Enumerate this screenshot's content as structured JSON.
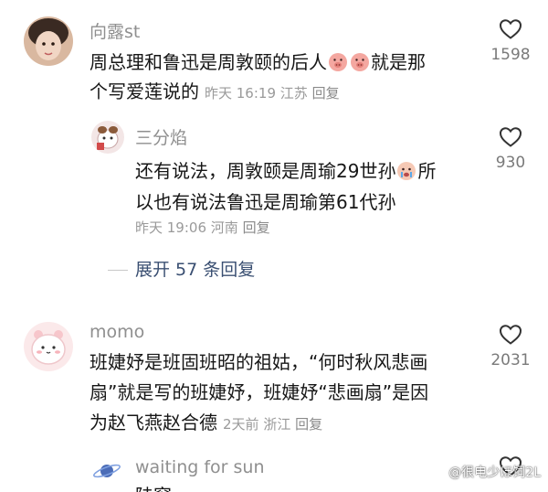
{
  "comments": [
    {
      "user": "向露st",
      "text_line1": "周总理和鲁迅是周敦颐的后人",
      "text_line1_after": "就是那",
      "text_line2": "个写爱莲说的",
      "time": "昨天 16:19",
      "location": "江苏",
      "reply_label": "回复",
      "likes": "1598",
      "emoji": [
        "pig-face-emoji",
        "pig-face-emoji"
      ]
    },
    {
      "user": "三分焰",
      "text_line1": "还有说法，周敦颐是周瑜29世孙",
      "text_line1_after": "所",
      "text_line2": "以也有说法鲁迅是周瑜第61代孙",
      "time": "昨天 19:06",
      "location": "河南",
      "reply_label": "回复",
      "likes": "930",
      "emoji": [
        "crying-face-emoji"
      ]
    },
    {
      "user": "momo",
      "text_line1": "班婕妤是班固班昭的祖姑，“何时秋风悲画",
      "text_line2": "扇”就是写的班婕妤，班婕妤“悲画扇”是因",
      "text_line3": "为赵飞燕赵合德",
      "time": "2天前",
      "location": "浙江",
      "reply_label": "回复",
      "likes": "2031"
    },
    {
      "user": "waiting for sun",
      "text_partial": "陆窗",
      "likes": "..."
    }
  ],
  "expand_replies": "展开 57 条回复",
  "watermark": "@很电少ほ饲2L",
  "colors": {
    "name": "#8f8f8f",
    "text": "#161616",
    "meta": "#9a9a9a",
    "expand": "#3a4f72",
    "like_icon": "#333333"
  }
}
